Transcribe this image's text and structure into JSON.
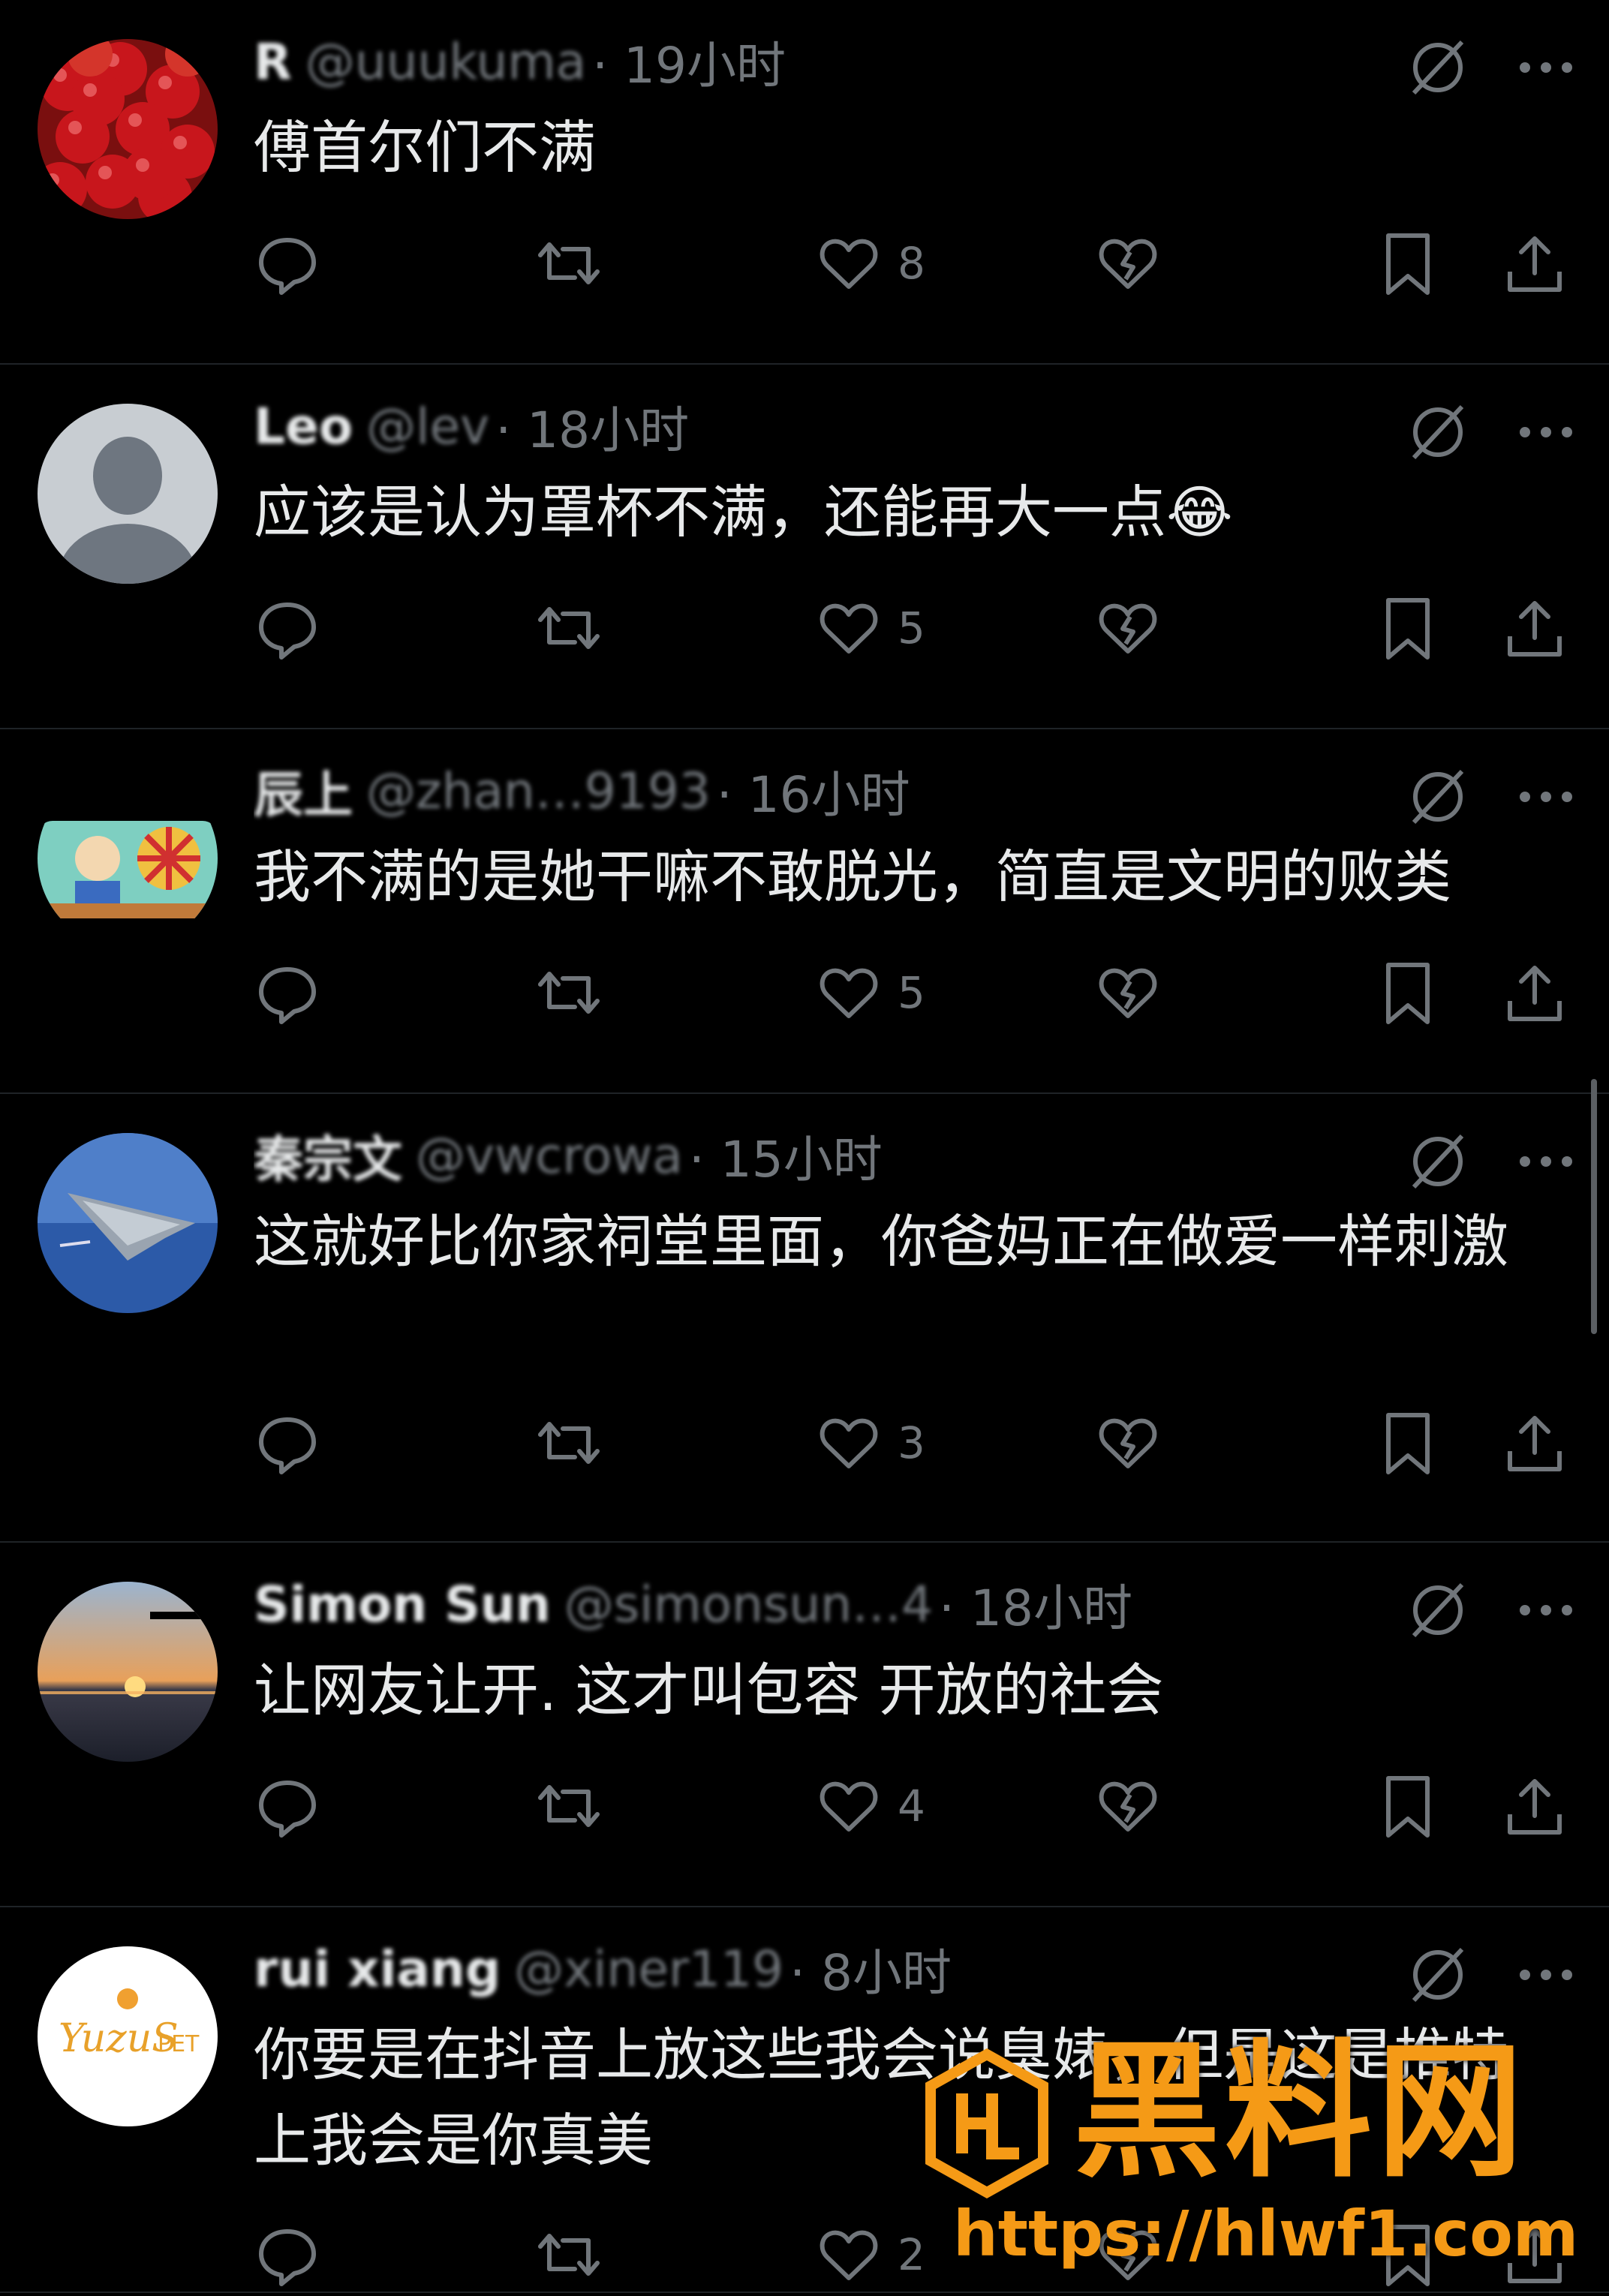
{
  "posts": [
    {
      "name": "R",
      "handle": "@uuukuma",
      "time": "· 19小时",
      "text": "傅首尔们不满",
      "likes": "8",
      "avatar": "tomatoes"
    },
    {
      "name": "Leo",
      "handle": "@lev",
      "time": "· 18小时",
      "text": "应该是认为罩杯不满，还能再大一点😂",
      "likes": "5",
      "avatar": "default"
    },
    {
      "name": "辰上",
      "handle": "@zhan…9193",
      "time": "· 16小时",
      "text": "我不满的是她干嘛不敢脱光，简直是文明的败类",
      "likes": "5",
      "avatar": "cartoon"
    },
    {
      "name": "秦宗文",
      "handle": "@vwcrowa",
      "time": "· 15小时",
      "text": "这就好比你家祠堂里面，你爸妈正在做爱一样刺激",
      "likes": "3",
      "avatar": "jet"
    },
    {
      "name": "Simon Sun",
      "handle": "@simonsun…4",
      "time": "· 18小时",
      "text": "让网友让开. 这才叫包容 开放的社会",
      "likes": "4",
      "avatar": "sunset"
    },
    {
      "name": "rui xiang",
      "handle": "@xiner119",
      "time": "· 8小时",
      "text": "你要是在抖音上放这些我会说臭婊，但是这是推特上我会是你真美",
      "likes": "2",
      "avatar": "yuzu"
    }
  ],
  "watermark": {
    "brand": "黑料网",
    "url": "https://hlwf1.com"
  },
  "icons": {
    "reply": "reply-icon",
    "repost": "repost-icon",
    "like": "heart-icon",
    "dislike": "broken-heart-icon",
    "bookmark": "bookmark-icon",
    "share": "share-icon",
    "grok": "grok-icon",
    "more": "more-icon"
  },
  "colors": {
    "background": "#000000",
    "text": "#e7e9ea",
    "muted": "#71767b",
    "divider": "#1f2327",
    "watermark": "#f59a16"
  }
}
